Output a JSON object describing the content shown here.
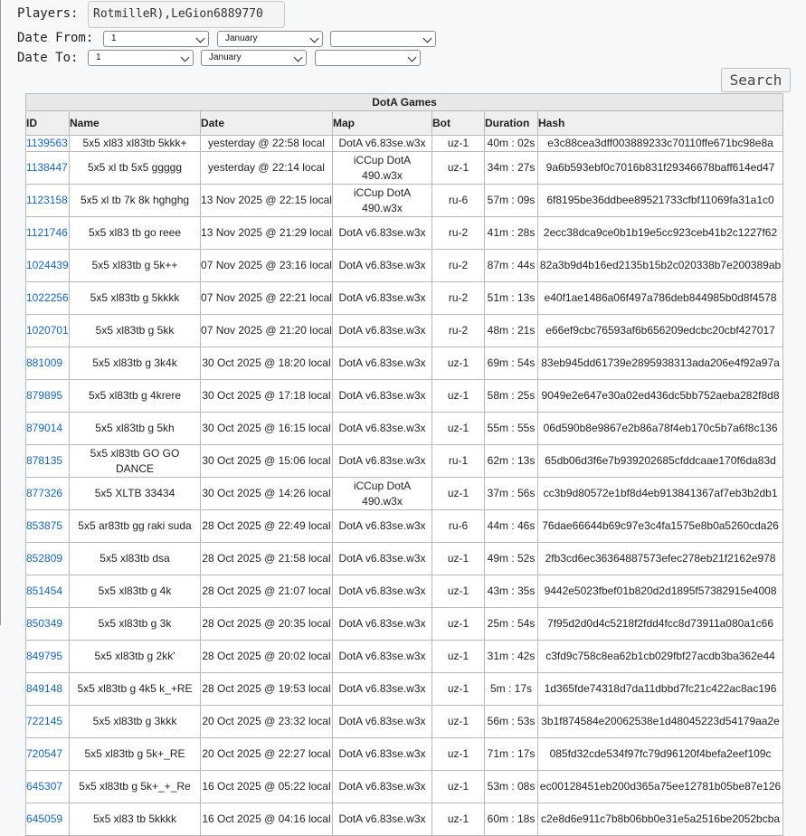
{
  "filters": {
    "players_label": "Players:",
    "players_value": "RotmilleR),LeGion6889770",
    "date_from_label": "Date From:",
    "date_to_label": "Date To:",
    "from_day": "1",
    "from_month": "January",
    "from_year": "",
    "to_day": "1",
    "to_month": "January",
    "to_year": "",
    "search_label": "Search"
  },
  "table": {
    "title": "DotA Games",
    "headers": [
      "ID",
      "Name",
      "Date",
      "Map",
      "Bot",
      "Duration",
      "Hash"
    ],
    "rows": [
      [
        "1139563",
        "5x5 xl83 xl83tb 5kkk+",
        "yesterday @ 22:58 local",
        "DotA v6.83se.w3x",
        "uz-1",
        "40m : 02s",
        "e3c88cea3dff003889233c70110ffe671bc98e8a"
      ],
      [
        "1138447",
        "5x5 xl tb 5x5 ggggg",
        "yesterday @ 22:14 local",
        "iCCup DotA 490.w3x",
        "uz-1",
        "34m : 27s",
        "9a6b593ebf0c7016b831f29346678baff614ed47"
      ],
      [
        "1123158",
        "5x5 xl tb 7k 8k hghghg",
        "13 Nov 2025 @ 22:15 local",
        "iCCup DotA 490.w3x",
        "ru-6",
        "57m : 09s",
        "6f8195be36ddbee89521733cfbf11069fa31a1c0"
      ],
      [
        "1121746",
        "5x5 xl83 tb go reee",
        "13 Nov 2025 @ 21:29 local",
        "DotA v6.83se.w3x",
        "ru-2",
        "41m : 28s",
        "2ecc38dca9ce0b1b19e5cc923ceb41b2c1227f62"
      ],
      [
        "1024439",
        "5x5 xl83tb g 5k++",
        "07 Nov 2025 @ 23:16 local",
        "DotA v6.83se.w3x",
        "ru-2",
        "87m : 44s",
        "82a3b9d4b16ed2135b15b2c020338b7e200389ab"
      ],
      [
        "1022256",
        "5x5 xl83tb g 5kkkk",
        "07 Nov 2025 @ 22:21 local",
        "DotA v6.83se.w3x",
        "ru-2",
        "51m : 13s",
        "e40f1ae1486a06f497a786deb844985b0d8f4578"
      ],
      [
        "1020701",
        "5x5 xl83tb g 5kk",
        "07 Nov 2025 @ 21:20 local",
        "DotA v6.83se.w3x",
        "ru-2",
        "48m : 21s",
        "e66ef9cbc76593af6b656209edcbc20cbf427017"
      ],
      [
        "881009",
        "5x5 xl83tb g 3k4k",
        "30 Oct 2025 @ 18:20 local",
        "DotA v6.83se.w3x",
        "uz-1",
        "69m : 54s",
        "83eb945dd61739e2895938313ada206e4f92a97a"
      ],
      [
        "879895",
        "5x5 xl83tb g 4krere",
        "30 Oct 2025 @ 17:18 local",
        "DotA v6.83se.w3x",
        "uz-1",
        "58m : 25s",
        "9049e2e647e30a02ed436dc5bb752aeba282f8d8"
      ],
      [
        "879014",
        "5x5 xl83tb g 5kh",
        "30 Oct 2025 @ 16:15 local",
        "DotA v6.83se.w3x",
        "uz-1",
        "55m : 55s",
        "06d590b8e9867e2b86a78f4eb170c5b7a6f8c136"
      ],
      [
        "878135",
        "5x5 xl83tb GO GO DANCE",
        "30 Oct 2025 @ 15:06 local",
        "DotA v6.83se.w3x",
        "ru-1",
        "62m : 13s",
        "65db06d3f6e7b939202685cfddcaae170f6da83d"
      ],
      [
        "877326",
        "5x5 XLTB 33434",
        "30 Oct 2025 @ 14:26 local",
        "iCCup DotA 490.w3x",
        "uz-1",
        "37m : 56s",
        "cc3b9d80572e1bf8d4eb913841367af7eb3b2db1"
      ],
      [
        "853875",
        "5x5 ar83tb gg raki suda",
        "28 Oct 2025 @ 22:49 local",
        "DotA v6.83se.w3x",
        "ru-6",
        "44m : 46s",
        "76dae66644b69c97e3c4fa1575e8b0a5260cda26"
      ],
      [
        "852809",
        "5x5 xl83tb dsa",
        "28 Oct 2025 @ 21:58 local",
        "DotA v6.83se.w3x",
        "uz-1",
        "49m : 52s",
        "2fb3cd6ec36364887573efec278eb21f2162e978"
      ],
      [
        "851454",
        "5x5 xl83tb g 4k",
        "28 Oct 2025 @ 21:07 local",
        "DotA v6.83se.w3x",
        "uz-1",
        "43m : 35s",
        "9442e5023fbef01b820d2d1895f57382915e4008"
      ],
      [
        "850349",
        "5x5 xl83tb g 3k",
        "28 Oct 2025 @ 20:35 local",
        "DotA v6.83se.w3x",
        "uz-1",
        "25m : 54s",
        "7f95d2d0d4c5218f2fdd4fcc8d73911a080a1c66"
      ],
      [
        "849795",
        "5x5 xl83tb g 2kk'",
        "28 Oct 2025 @ 20:02 local",
        "DotA v6.83se.w3x",
        "uz-1",
        "31m : 42s",
        "c3fd9c758c8ea62b1cb029fbf27acdb3ba362e44"
      ],
      [
        "849148",
        "5x5 xl83tb g 4k5 k_+RE",
        "28 Oct 2025 @ 19:53 local",
        "DotA v6.83se.w3x",
        "uz-1",
        "5m : 17s",
        "1d365fde74318d7da11dbbd7fc21c422ac8ac196"
      ],
      [
        "722145",
        "5x5 xl83tb g 3kkk",
        "20 Oct 2025 @ 23:32 local",
        "DotA v6.83se.w3x",
        "uz-1",
        "56m : 53s",
        "3b1f874584e20062538e1d48045223d54179aa2e"
      ],
      [
        "720547",
        "5x5 xl83tb g 5k+_RE",
        "20 Oct 2025 @ 22:27 local",
        "DotA v6.83se.w3x",
        "uz-1",
        "71m : 17s",
        "085fd32cde534f97fc79d96120f4befa2eef109c"
      ],
      [
        "645307",
        "5x5 xl83tb g 5k+_+_Re",
        "16 Oct 2025 @ 05:22 local",
        "DotA v6.83se.w3x",
        "uz-1",
        "53m : 08s",
        "ec00128451eb200d365a75ee12781b05be87e126"
      ],
      [
        "645059",
        "5x5 xl83 tb 5kkkk",
        "16 Oct 2025 @ 04:16 local",
        "DotA v6.83se.w3x",
        "uz-1",
        "60m : 18s",
        "c2e8d6e911c7b8b06bb0e31e5a2516be2052bcba"
      ]
    ]
  }
}
